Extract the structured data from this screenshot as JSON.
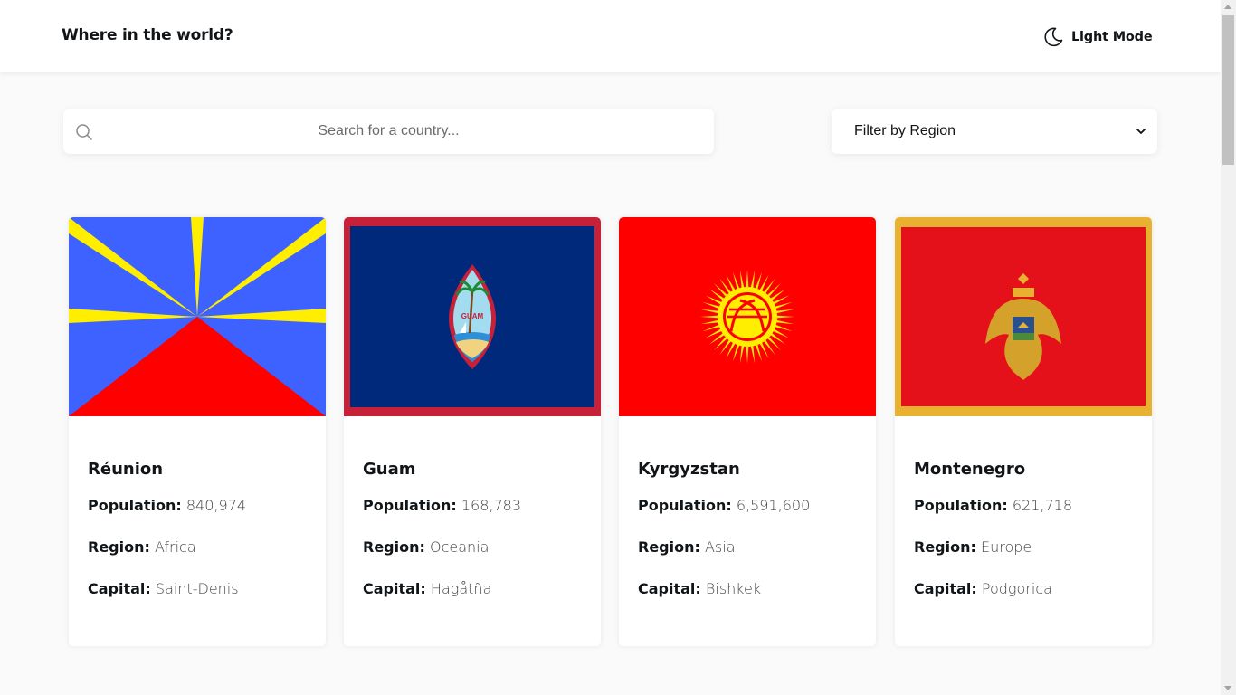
{
  "header": {
    "title": "Where in the world?",
    "mode_label": "Light Mode",
    "mode_icon": "moon-icon"
  },
  "search": {
    "placeholder": "Search for a country...",
    "icon": "search-icon"
  },
  "filter": {
    "label": "Filter by Region",
    "icon": "chevron-down-icon"
  },
  "labels": {
    "population": "Population:",
    "region": "Region:",
    "capital": "Capital:"
  },
  "countries": [
    {
      "name": "Réunion",
      "population": "840,974",
      "region": "Africa",
      "capital": "Saint-Denis"
    },
    {
      "name": "Guam",
      "population": "168,783",
      "region": "Oceania",
      "capital": "Hagåtña"
    },
    {
      "name": "Kyrgyzstan",
      "population": "6,591,600",
      "region": "Asia",
      "capital": "Bishkek"
    },
    {
      "name": "Montenegro",
      "population": "621,718",
      "region": "Europe",
      "capital": "Podgorica"
    }
  ],
  "colors": {
    "background": "#fafafa",
    "card": "#ffffff",
    "text": "#111517"
  }
}
